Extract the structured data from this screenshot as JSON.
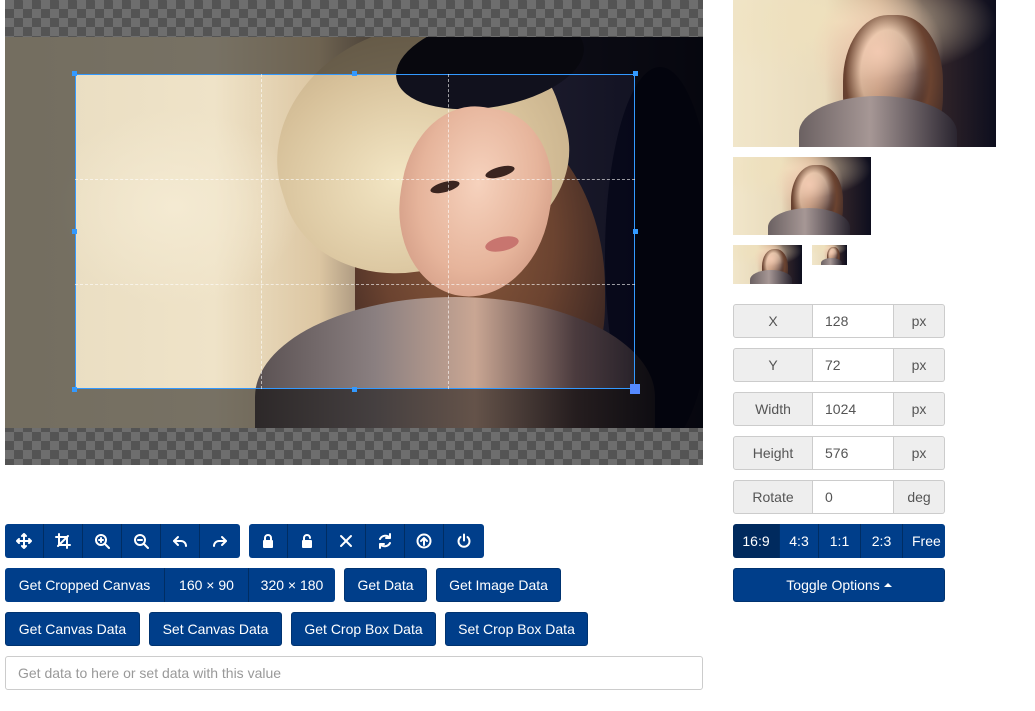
{
  "toolbar": {
    "mode_buttons": [
      {
        "name": "move-icon"
      },
      {
        "name": "crop-icon"
      },
      {
        "name": "zoom-in-icon"
      },
      {
        "name": "zoom-out-icon"
      },
      {
        "name": "rotate-left-icon"
      },
      {
        "name": "rotate-right-icon"
      }
    ],
    "state_buttons": [
      {
        "name": "lock-icon"
      },
      {
        "name": "unlock-icon"
      },
      {
        "name": "clear-icon"
      },
      {
        "name": "reset-icon"
      },
      {
        "name": "upload-icon"
      },
      {
        "name": "power-icon"
      }
    ]
  },
  "actions": {
    "get_cropped_canvas": "Get Cropped Canvas",
    "size_small": "160 × 90",
    "size_large": "320 × 180",
    "get_data": "Get Data",
    "get_image_data": "Get Image Data",
    "get_canvas_data": "Get Canvas Data",
    "set_canvas_data": "Set Canvas Data",
    "get_crop_box_data": "Get Crop Box Data",
    "set_crop_box_data": "Set Crop Box Data"
  },
  "data_input": {
    "placeholder": "Get data to here or set data with this value",
    "value": ""
  },
  "fields": {
    "x": {
      "label": "X",
      "value": "128",
      "unit": "px"
    },
    "y": {
      "label": "Y",
      "value": "72",
      "unit": "px"
    },
    "width": {
      "label": "Width",
      "value": "1024",
      "unit": "px"
    },
    "height": {
      "label": "Height",
      "value": "576",
      "unit": "px"
    },
    "rotate": {
      "label": "Rotate",
      "value": "0",
      "unit": "deg"
    }
  },
  "aspect_ratios": {
    "options": [
      "16:9",
      "4:3",
      "1:1",
      "2:3",
      "Free"
    ],
    "selected": "16:9"
  },
  "toggle_options": "Toggle Options",
  "colors": {
    "button_primary": "#003e8a",
    "button_active": "#002a5e",
    "crop_outline": "#3399ff"
  }
}
